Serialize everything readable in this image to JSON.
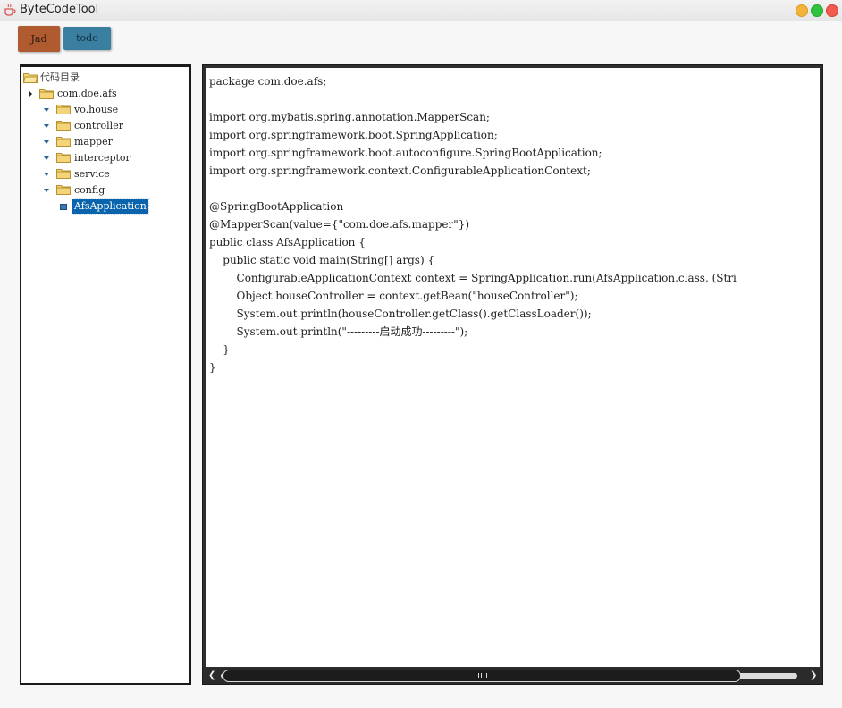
{
  "window": {
    "title": "ByteCodeTool"
  },
  "tabs": [
    {
      "label": "Jad",
      "color": "#b05a2f"
    },
    {
      "label": "todo",
      "color": "#3a7fa0"
    }
  ],
  "tree": {
    "root": "代码目录",
    "package": "com.doe.afs",
    "folders": [
      "vo.house",
      "controller",
      "mapper",
      "interceptor",
      "service",
      "config"
    ],
    "selected_file": "AfsApplication",
    "selection_color": "#0a64ad"
  },
  "code": {
    "lines": [
      "package com.doe.afs;",
      "",
      "import org.mybatis.spring.annotation.MapperScan;",
      "import org.springframework.boot.SpringApplication;",
      "import org.springframework.boot.autoconfigure.SpringBootApplication;",
      "import org.springframework.context.ConfigurableApplicationContext;",
      "",
      "@SpringBootApplication",
      "@MapperScan(value={\"com.doe.afs.mapper\"})",
      "public class AfsApplication {",
      "    public static void main(String[] args) {",
      "        ConfigurableApplicationContext context = SpringApplication.run(AfsApplication.class, (Stri",
      "        Object houseController = context.getBean(\"houseController\");",
      "        System.out.println(houseController.getClass().getClassLoader());",
      "        System.out.println(\"---------启动成功---------\");",
      "    }",
      "}"
    ]
  }
}
